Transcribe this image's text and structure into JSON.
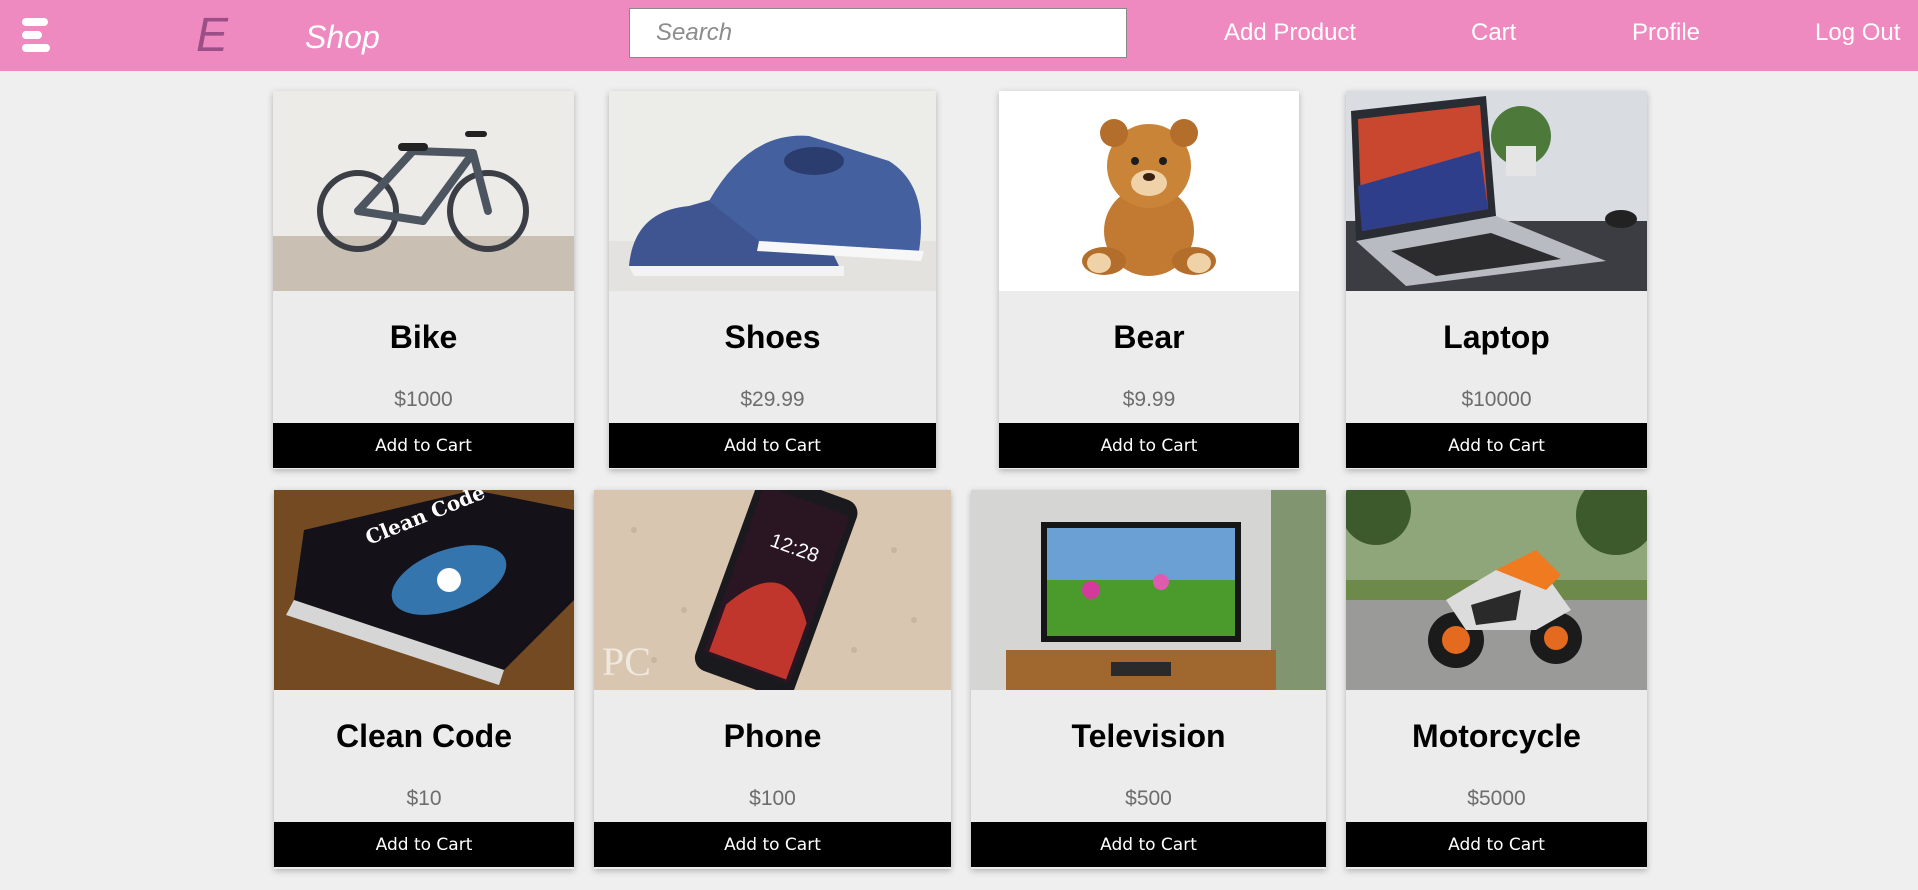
{
  "header": {
    "logo_letter": "E",
    "brand": "Shop",
    "search_placeholder": "Search",
    "nav": {
      "add_product": "Add Product",
      "cart": "Cart",
      "profile": "Profile",
      "log_out": "Log Out"
    }
  },
  "colors": {
    "navbar": "#ef8ac1",
    "logo": "#9b4f86",
    "button": "#000000"
  },
  "products": [
    {
      "name": "Bike",
      "price": "$1000",
      "button": "Add to Cart",
      "image": "bike-image"
    },
    {
      "name": "Shoes",
      "price": "$29.99",
      "button": "Add to Cart",
      "image": "shoes-image"
    },
    {
      "name": "Bear",
      "price": "$9.99",
      "button": "Add to Cart",
      "image": "teddy-bear-image"
    },
    {
      "name": "Laptop",
      "price": "$10000",
      "button": "Add to Cart",
      "image": "laptop-image"
    },
    {
      "name": "Clean Code",
      "price": "$10",
      "button": "Add to Cart",
      "image": "book-image"
    },
    {
      "name": "Phone",
      "price": "$100",
      "button": "Add to Cart",
      "image": "phone-image"
    },
    {
      "name": "Television",
      "price": "$500",
      "button": "Add to Cart",
      "image": "television-image"
    },
    {
      "name": "Motorcycle",
      "price": "$5000",
      "button": "Add to Cart",
      "image": "motorcycle-image"
    }
  ]
}
